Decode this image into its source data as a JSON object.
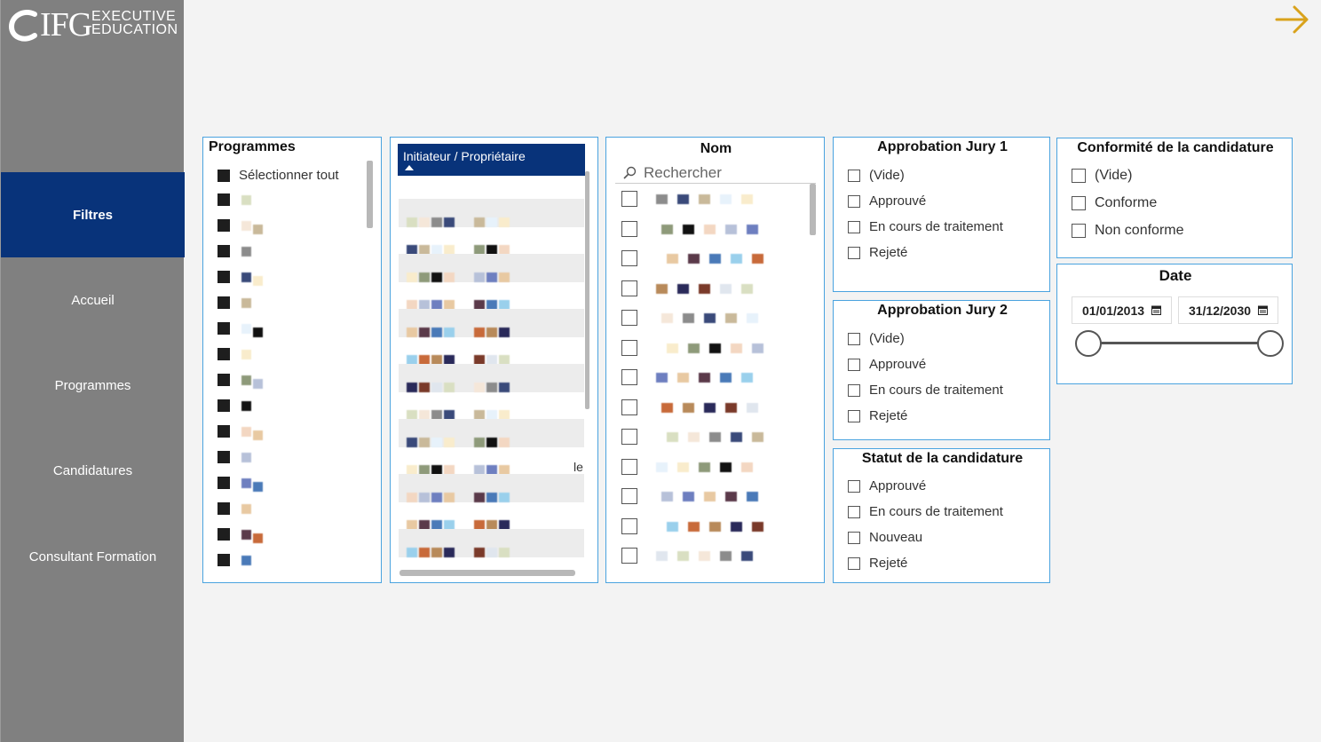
{
  "logo": {
    "brand": "IFG",
    "line1": "EXECUTIVE",
    "line2": "EDUCATION"
  },
  "nav": {
    "items": [
      {
        "label": "Filtres",
        "active": true
      },
      {
        "label": "Accueil"
      },
      {
        "label": "Programmes"
      },
      {
        "label": "Candidatures"
      },
      {
        "label": "Consultant Formation"
      }
    ]
  },
  "programmes": {
    "title": "Programmes",
    "select_all": "Sélectionner tout"
  },
  "initiateur": {
    "header": "Initiateur / Propriétaire",
    "partial_text": "le"
  },
  "nom": {
    "title": "Nom",
    "search_placeholder": "Rechercher"
  },
  "jury1": {
    "title": "Approbation Jury 1",
    "options": [
      "(Vide)",
      "Approuvé",
      "En cours de traitement",
      "Rejeté"
    ]
  },
  "jury2": {
    "title": "Approbation Jury 2",
    "options": [
      "(Vide)",
      "Approuvé",
      "En cours de traitement",
      "Rejeté"
    ]
  },
  "statut": {
    "title": "Statut de la candidature",
    "options": [
      "Approuvé",
      "En cours de traitement",
      "Nouveau",
      "Rejeté"
    ]
  },
  "conformite": {
    "title": "Conformité de la candidature",
    "options": [
      "(Vide)",
      "Conforme",
      "Non conforme"
    ]
  },
  "date": {
    "title": "Date",
    "start": "01/01/2013",
    "end": "31/12/2030"
  },
  "colors": {
    "nav_active": "#08337a",
    "card_border": "#4aa3df",
    "arrow": "#d9a21b",
    "sidebar": "#808080"
  },
  "icons": {
    "next": "arrow-right-icon",
    "search": "search-icon",
    "calendar": "calendar-icon"
  }
}
